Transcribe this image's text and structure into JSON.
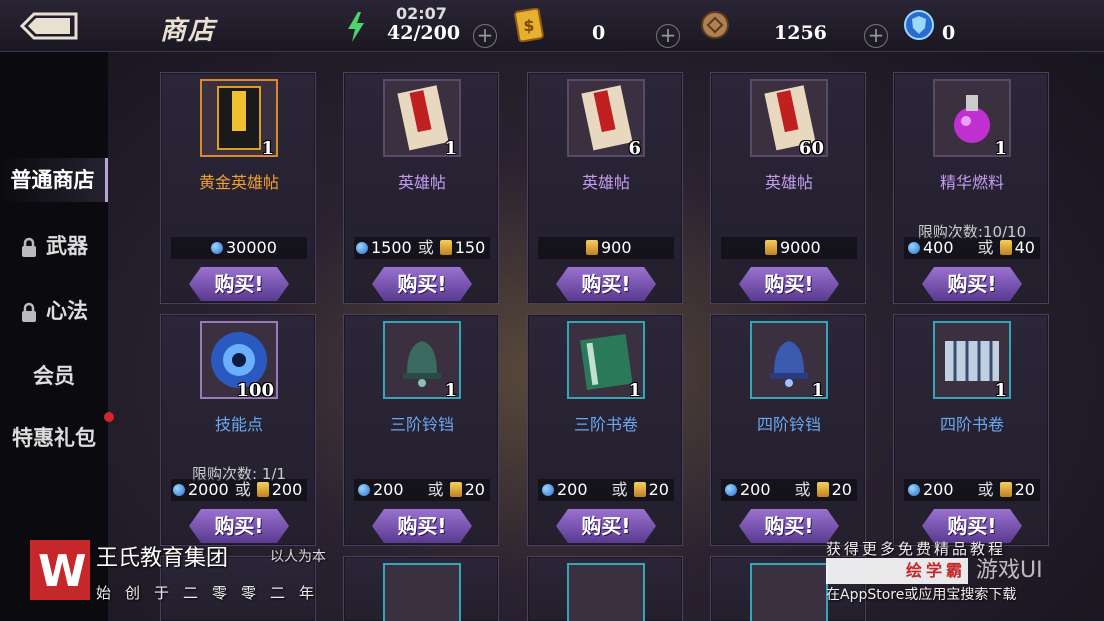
{
  "header": {
    "title": "商店",
    "stamina_time": "02:07",
    "stamina": "42/200",
    "gold_count": "0",
    "coin_count": "1256",
    "gem_count": "0"
  },
  "sidebar": {
    "items": [
      {
        "label": "普通商店",
        "locked": false,
        "active": true
      },
      {
        "label": "武器",
        "locked": true
      },
      {
        "label": "心法",
        "locked": true
      },
      {
        "label": "会员",
        "locked": false
      },
      {
        "label": "特惠礼包",
        "locked": false,
        "badge": true
      }
    ]
  },
  "buy_label": "购买!",
  "or_label": "或",
  "items": [
    {
      "name": "黄金英雄帖",
      "qty": "1",
      "price_gem": "30000",
      "price_gold": "",
      "limit": ""
    },
    {
      "name": "英雄帖",
      "qty": "1",
      "price_gem": "1500",
      "price_gold": "150",
      "limit": ""
    },
    {
      "name": "英雄帖",
      "qty": "6",
      "price_gem": "",
      "price_gold": "900",
      "limit": ""
    },
    {
      "name": "英雄帖",
      "qty": "60",
      "price_gem": "",
      "price_gold": "9000",
      "limit": ""
    },
    {
      "name": "精华燃料",
      "qty": "1",
      "price_gem": "400",
      "price_gold": "40",
      "limit": "限购次数:10/10"
    },
    {
      "name": "技能点",
      "qty": "100",
      "price_gem": "2000",
      "price_gold": "200",
      "limit": "限购次数: 1/1"
    },
    {
      "name": "三阶铃铛",
      "qty": "1",
      "price_gem": "200",
      "price_gold": "20",
      "limit": ""
    },
    {
      "name": "三阶书卷",
      "qty": "1",
      "price_gem": "200",
      "price_gold": "20",
      "limit": ""
    },
    {
      "name": "四阶铃铛",
      "qty": "1",
      "price_gem": "200",
      "price_gold": "20",
      "limit": ""
    },
    {
      "name": "四阶书卷",
      "qty": "1",
      "price_gem": "200",
      "price_gold": "20",
      "limit": ""
    }
  ],
  "watermark": {
    "logo_letter": "W",
    "org_name": "王氏教育集团",
    "slogan": "以人为本",
    "since": "始创于二零零二年",
    "promo_top": "获得更多免费精品教程",
    "brand": "绘学霸",
    "brand_game": "游戏UI",
    "promo_bottom": "在AppStore或应用宝搜索下载"
  },
  "colors": {
    "accent_purple": "#9a72d0",
    "name_orange": "#f0a030",
    "name_purple": "#c49cf0",
    "name_blue": "#6aa8f0",
    "badge_red": "#d9232a"
  }
}
